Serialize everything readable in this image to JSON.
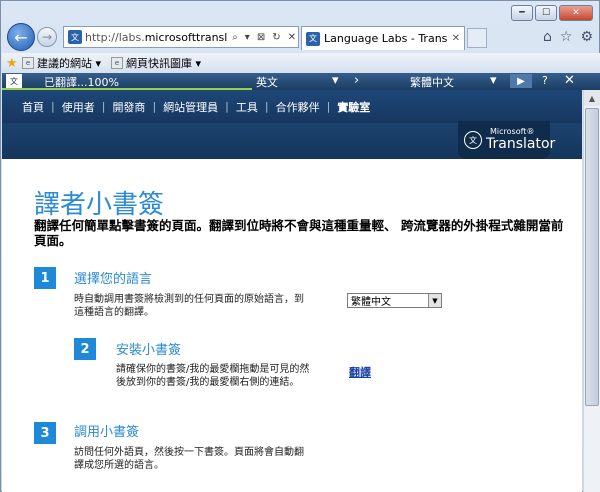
{
  "browser": {
    "url_prefix": "http://labs.",
    "url_domain": "microsofttranslator.",
    "url_suffix": "...",
    "tab_title": "Language Labs - Translat...",
    "nav_back_icon": "arrow-left",
    "nav_forward_icon": "arrow-right",
    "address_controls": [
      "⌕",
      "▾",
      "⊠",
      "↻",
      "✕"
    ]
  },
  "favorites_bar": {
    "items": [
      "建議的網站 ▾",
      "網頁快訊圖庫 ▾"
    ]
  },
  "translator_bar": {
    "status": "已翻譯...100%",
    "progress": 1.0,
    "from_lang": "英文",
    "to_lang": "繁體中文",
    "help": "?",
    "close": "✕"
  },
  "site_nav": {
    "items": [
      "首頁",
      "使用者",
      "開發商",
      "網站管理員",
      "工具",
      "合作夥伴",
      "實驗室"
    ],
    "active_index": 6
  },
  "logo": {
    "brand": "Microsoft®",
    "product": "Translator"
  },
  "main": {
    "title": "譯者小書簽",
    "subtitle": "翻譯任何簡單點擊書簽的頁面。翻譯到位時將不會與這種重量輕、 跨流覽器的外掛程式雜開當前頁面。",
    "steps": [
      {
        "num": "1",
        "title": "選擇您的語言",
        "desc": "時自動調用書簽將檢測到的任何頁面的原始語言，到這種語言的翻譯。"
      },
      {
        "num": "2",
        "title": "安裝小書簽",
        "desc": "請確保你的書簽/我的最愛欄拖動是可見的然後放到你的書簽/我的最愛欄右側的連結。"
      },
      {
        "num": "3",
        "title": "調用小書簽",
        "desc": "訪問任何外語頁，然後按一下書簽。頁面將會自動翻譯成您所選的語言。"
      }
    ],
    "language_select": "繁體中文",
    "bookmarklet_link": "翻譯"
  }
}
